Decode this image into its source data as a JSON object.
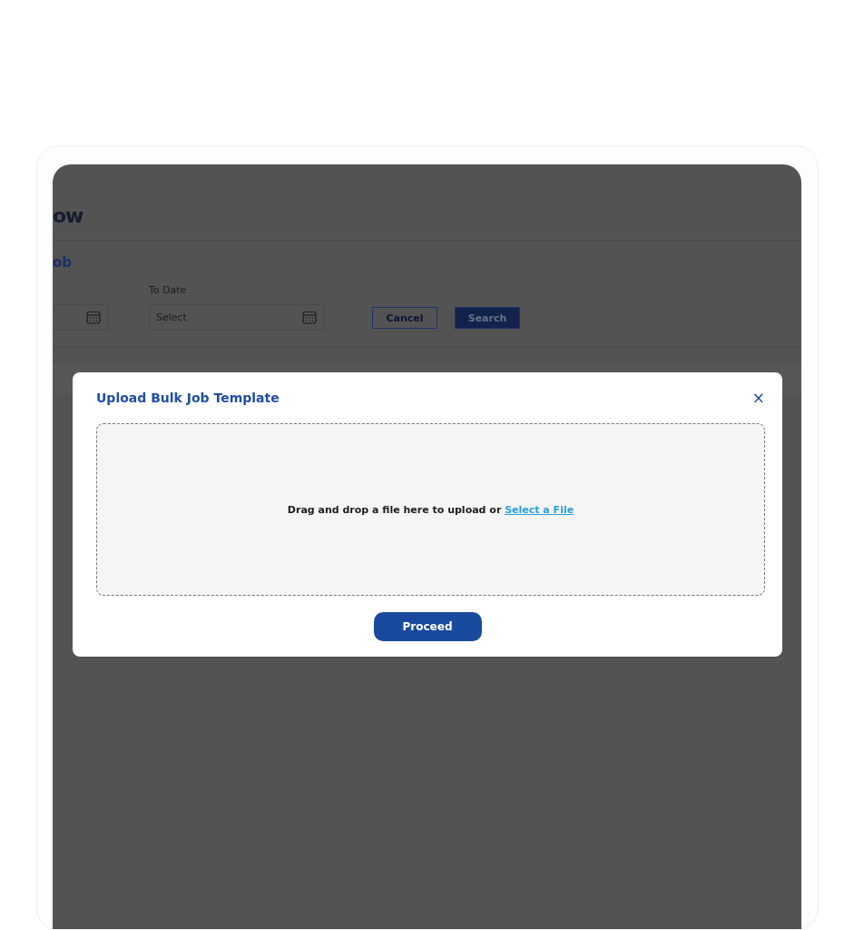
{
  "background": {
    "page_title": "ow",
    "section_title": "ob",
    "filters": [
      {
        "kind": "partial"
      },
      {
        "kind": "date",
        "label": "To Date",
        "value": "Select"
      }
    ],
    "buttons": [
      {
        "label": "Cancel",
        "kind": "outline"
      },
      {
        "label": "Search",
        "kind": "solid"
      }
    ]
  },
  "modal": {
    "title": "Upload Bulk Job Template",
    "close": "×",
    "dropzone": {
      "text": "Drag and drop a file here to upload or ",
      "link": "Select a File"
    },
    "primary_button": "Proceed"
  }
}
